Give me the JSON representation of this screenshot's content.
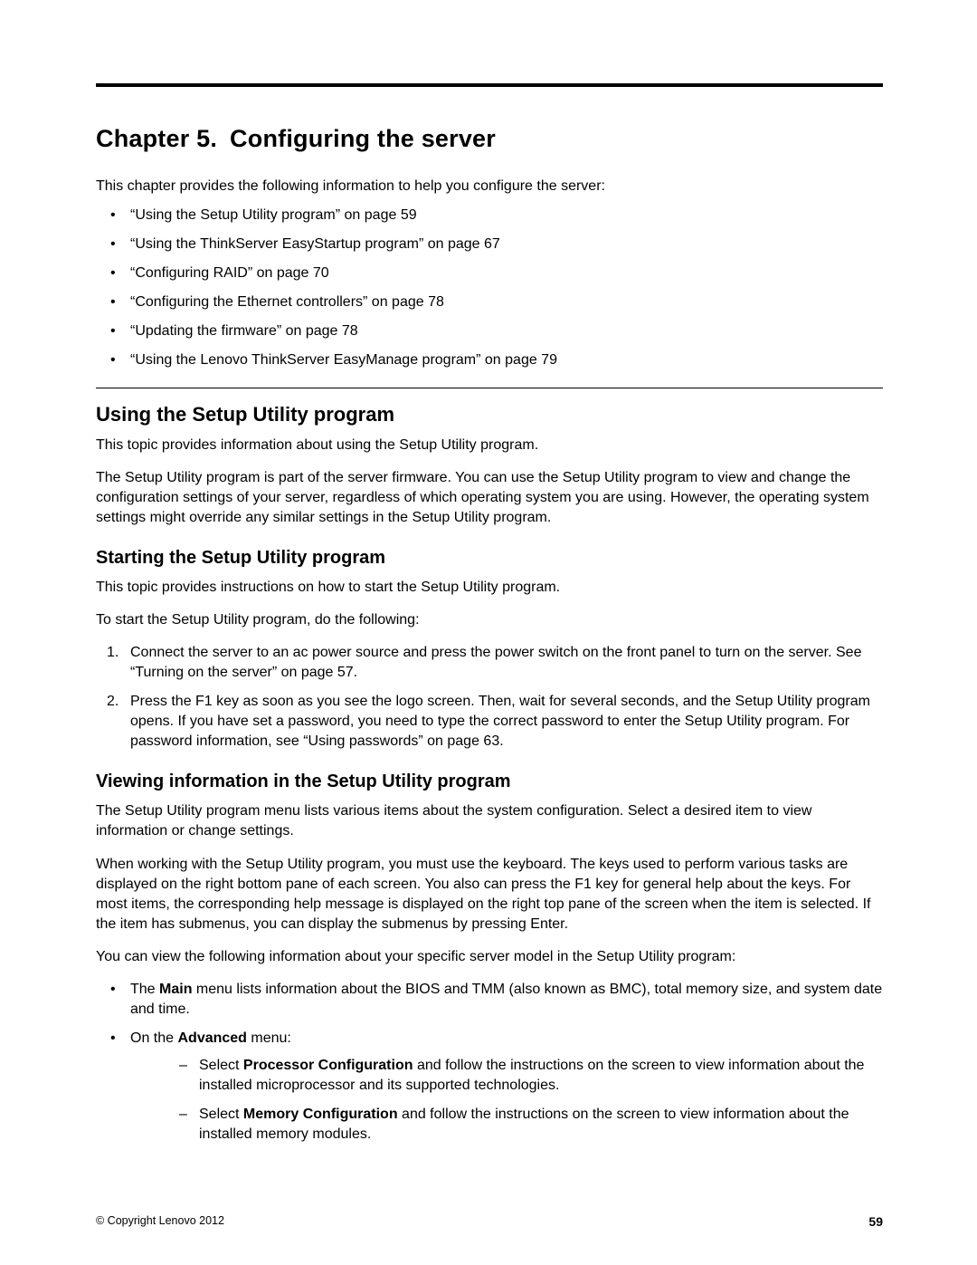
{
  "chapter": {
    "label": "Chapter 5.",
    "title": "Configuring the server"
  },
  "intro": "This chapter provides the following information to help you configure the server:",
  "toc": [
    "“Using the Setup Utility program” on page 59",
    "“Using the ThinkServer EasyStartup program” on page 67",
    "“Configuring RAID” on page 70",
    "“Configuring the Ethernet controllers” on page 78",
    "“Updating the firmware” on page 78",
    "“Using the Lenovo ThinkServer EasyManage program” on page 79"
  ],
  "s1": {
    "title": "Using the Setup Utility program",
    "p1": "This topic provides information about using the Setup Utility program.",
    "p2": "The Setup Utility program is part of the server firmware. You can use the Setup Utility program to view and change the configuration settings of your server, regardless of which operating system you are using. However, the operating system settings might override any similar settings in the Setup Utility program."
  },
  "s2": {
    "title": "Starting the Setup Utility program",
    "p1": "This topic provides instructions on how to start the Setup Utility program.",
    "p2": "To start the Setup Utility program, do the following:",
    "steps": [
      "Connect the server to an ac power source and press the power switch on the front panel to turn on the server. See “Turning on the server” on page 57.",
      "Press the F1 key as soon as you see the logo screen. Then, wait for several seconds, and the Setup Utility program opens. If you have set a password, you need to type the correct password to enter the Setup Utility program. For password information, see “Using passwords” on page 63."
    ]
  },
  "s3": {
    "title": "Viewing information in the Setup Utility program",
    "p1": "The Setup Utility program menu lists various items about the system configuration. Select a desired item to view information or change settings.",
    "p2": "When working with the Setup Utility program, you must use the keyboard. The keys used to perform various tasks are displayed on the right bottom pane of each screen. You also can press the F1 key for general help about the keys. For most items, the corresponding help message is displayed on the right top pane of the screen when the item is selected. If the item has submenus, you can display the submenus by pressing Enter.",
    "p3": "You can view the following information about your specific server model in the Setup Utility program:",
    "b1_pre": "The ",
    "b1_bold": "Main",
    "b1_post": " menu lists information about the BIOS and TMM (also known as BMC), total memory size, and system date and time.",
    "b2_pre": "On the ",
    "b2_bold": "Advanced",
    "b2_post": " menu:",
    "n1_pre": "Select ",
    "n1_bold": "Processor Configuration",
    "n1_post": " and follow the instructions on the screen to view information about the installed microprocessor and its supported technologies.",
    "n2_pre": "Select ",
    "n2_bold": "Memory Configuration",
    "n2_post": " and follow the instructions on the screen to view information about the installed memory modules."
  },
  "footer": {
    "copyright": "© Copyright Lenovo 2012",
    "pagenum": "59"
  }
}
